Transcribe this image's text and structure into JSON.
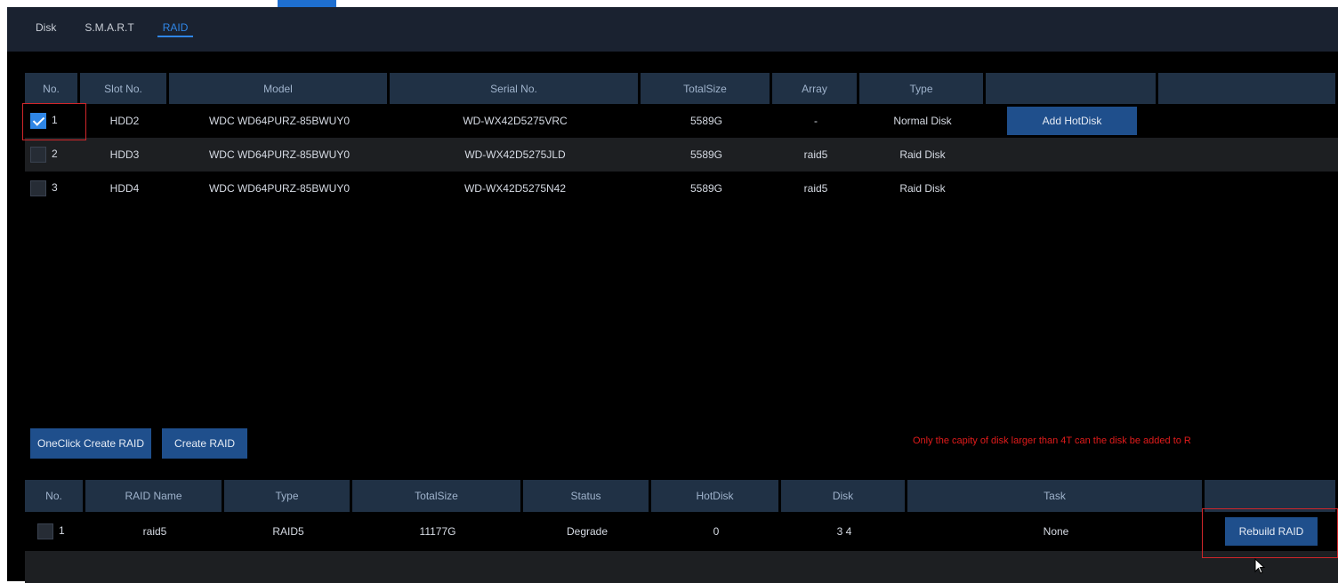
{
  "tabs": [
    {
      "label": "Disk"
    },
    {
      "label": "S.M.A.R.T"
    },
    {
      "label": "RAID",
      "active": true
    }
  ],
  "disk_table": {
    "headers": [
      "No.",
      "Slot No.",
      "Model",
      "Serial No.",
      "TotalSize",
      "Array",
      "Type",
      "",
      ""
    ],
    "rows": [
      {
        "no": "1",
        "checked": true,
        "slot": "HDD2",
        "model": "WDC WD64PURZ-85BWUY0",
        "serial": "WD-WX42D5275VRC",
        "size": "5589G",
        "array": "-",
        "type": "Normal Disk",
        "action": "Add HotDisk"
      },
      {
        "no": "2",
        "checked": false,
        "slot": "HDD3",
        "model": "WDC WD64PURZ-85BWUY0",
        "serial": "WD-WX42D5275JLD",
        "size": "5589G",
        "array": "raid5",
        "type": "Raid Disk",
        "action": ""
      },
      {
        "no": "3",
        "checked": false,
        "slot": "HDD4",
        "model": "WDC WD64PURZ-85BWUY0",
        "serial": "WD-WX42D5275N42",
        "size": "5589G",
        "array": "raid5",
        "type": "Raid Disk",
        "action": ""
      }
    ]
  },
  "actions": {
    "oneclick_label": "OneClick Create RAID",
    "create_label": "Create RAID"
  },
  "notice": "Only the capity of disk larger than 4T can the disk be added to R",
  "raid_table": {
    "headers": [
      "No.",
      "RAID Name",
      "Type",
      "TotalSize",
      "Status",
      "HotDisk",
      "Disk",
      "Task",
      ""
    ],
    "rows": [
      {
        "no": "1",
        "checked": false,
        "name": "raid5",
        "type": "RAID5",
        "size": "11177G",
        "status": "Degrade",
        "hotdisk": "0",
        "disk": "3 4",
        "task": "None",
        "action": "Rebuild RAID"
      }
    ]
  },
  "colors": {
    "accent": "#2f86e6",
    "header_bg": "#203145",
    "button_bg": "#1f4f8c",
    "warning": "#e21b1b"
  }
}
